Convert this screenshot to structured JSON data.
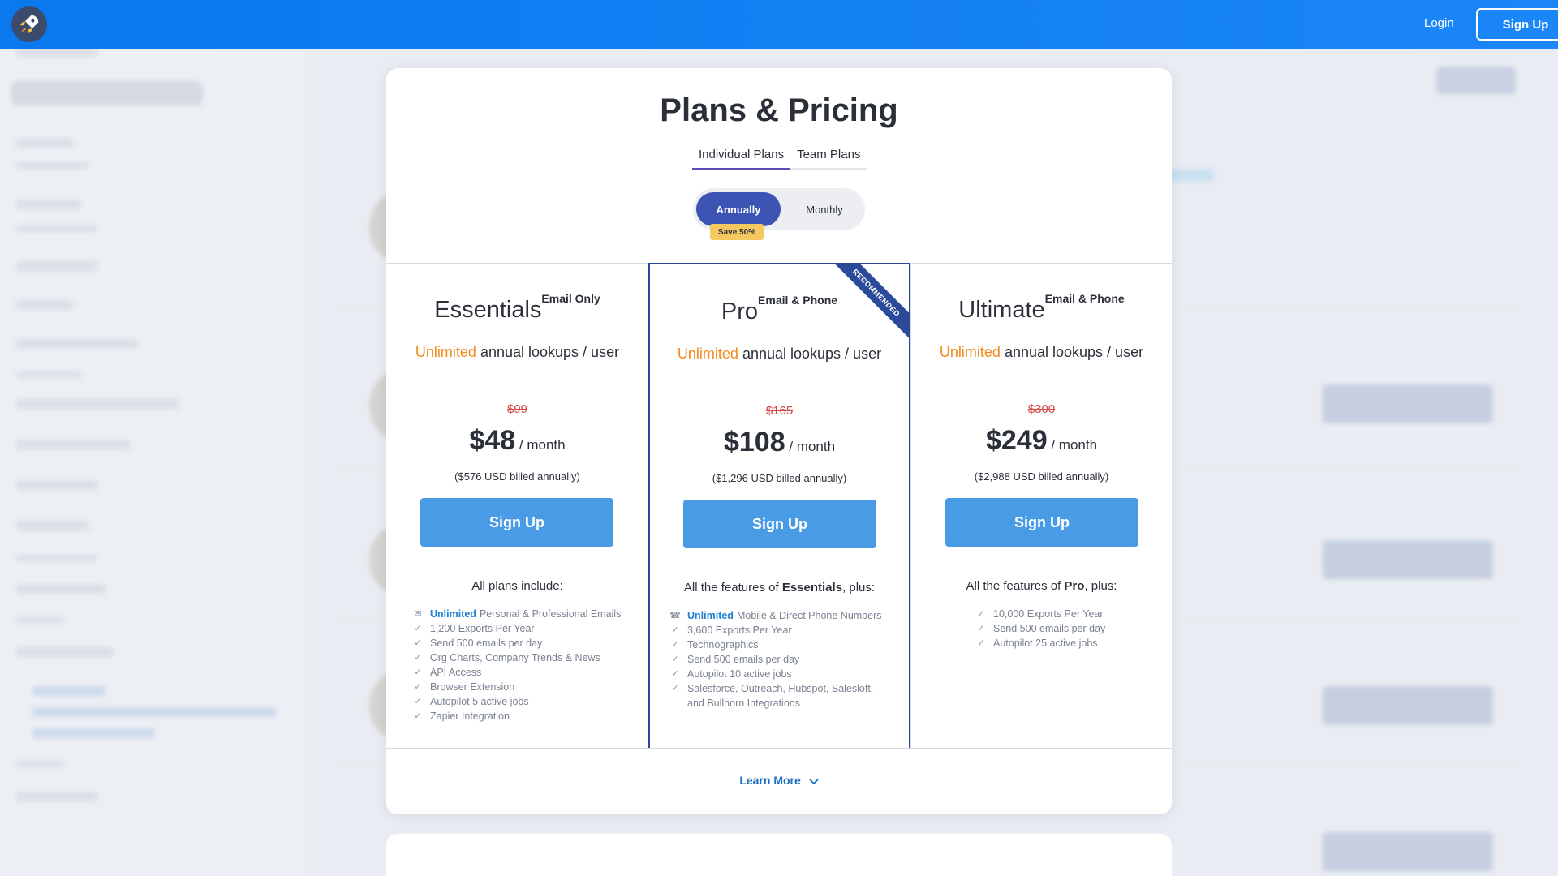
{
  "topbar": {
    "login": "Login",
    "signup": "Sign Up"
  },
  "modal": {
    "title": "Plans & Pricing",
    "tabs": [
      {
        "label": "Individual Plans",
        "active": true
      },
      {
        "label": "Team Plans",
        "active": false
      }
    ],
    "billing_toggle": {
      "annually": "Annually",
      "monthly": "Monthly",
      "save_badge": "Save 50%"
    },
    "plans": [
      {
        "name": "Essentials",
        "tag": "Email Only",
        "unlimited": "Unlimited",
        "lookups": " annual lookups / user",
        "old_price": "$99",
        "price": "$48",
        "per": " / month",
        "billed": "($576 USD billed annually)",
        "cta": "Sign Up",
        "includes_prefix": "All plans include:",
        "includes_bold": "",
        "includes_suffix": "",
        "features": [
          {
            "icon": "mail-icon",
            "highlight": "Unlimited",
            "text": "Personal & Professional Emails"
          },
          {
            "icon": "check-icon",
            "highlight": "",
            "text": "1,200 Exports Per Year"
          },
          {
            "icon": "check-icon",
            "highlight": "",
            "text": "Send 500 emails per day"
          },
          {
            "icon": "check-icon",
            "highlight": "",
            "text": "Org Charts, Company Trends & News"
          },
          {
            "icon": "check-icon",
            "highlight": "",
            "text": "API Access"
          },
          {
            "icon": "check-icon",
            "highlight": "",
            "text": "Browser Extension"
          },
          {
            "icon": "check-icon",
            "highlight": "",
            "text": "Autopilot 5 active jobs"
          },
          {
            "icon": "check-icon",
            "highlight": "",
            "text": "Zapier Integration"
          }
        ]
      },
      {
        "name": "Pro",
        "tag": "Email & Phone",
        "ribbon": "RECOMMENDED",
        "unlimited": "Unlimited",
        "lookups": " annual lookups / user",
        "old_price": "$165",
        "price": "$108",
        "per": " / month",
        "billed": "($1,296 USD billed annually)",
        "cta": "Sign Up",
        "includes_prefix": "All the features of ",
        "includes_bold": "Essentials",
        "includes_suffix": ", plus:",
        "features": [
          {
            "icon": "phone-icon",
            "highlight": "Unlimited",
            "text": "Mobile & Direct Phone Numbers"
          },
          {
            "icon": "check-icon",
            "highlight": "",
            "text": "3,600 Exports Per Year"
          },
          {
            "icon": "check-icon",
            "highlight": "",
            "text": "Technographics"
          },
          {
            "icon": "check-icon",
            "highlight": "",
            "text": "Send 500 emails per day"
          },
          {
            "icon": "check-icon",
            "highlight": "",
            "text": "Autopilot 10 active jobs"
          },
          {
            "icon": "check-icon",
            "highlight": "",
            "text": "Salesforce, Outreach, Hubspot, Salesloft,"
          },
          {
            "icon": "",
            "highlight": "",
            "text": "and Bullhorn Integrations"
          }
        ]
      },
      {
        "name": "Ultimate",
        "tag": "Email & Phone",
        "unlimited": "Unlimited",
        "lookups": " annual lookups / user",
        "old_price": "$300",
        "price": "$249",
        "per": " / month",
        "billed": "($2,988 USD billed annually)",
        "cta": "Sign Up",
        "includes_prefix": "All the features of ",
        "includes_bold": "Pro",
        "includes_suffix": ", plus:",
        "features": [
          {
            "icon": "check-icon",
            "highlight": "",
            "text": "10,000 Exports Per Year"
          },
          {
            "icon": "check-icon",
            "highlight": "",
            "text": "Send 500 emails per day"
          },
          {
            "icon": "check-icon",
            "highlight": "",
            "text": "Autopilot 25 active jobs"
          }
        ]
      }
    ],
    "learn_more": "Learn More"
  }
}
